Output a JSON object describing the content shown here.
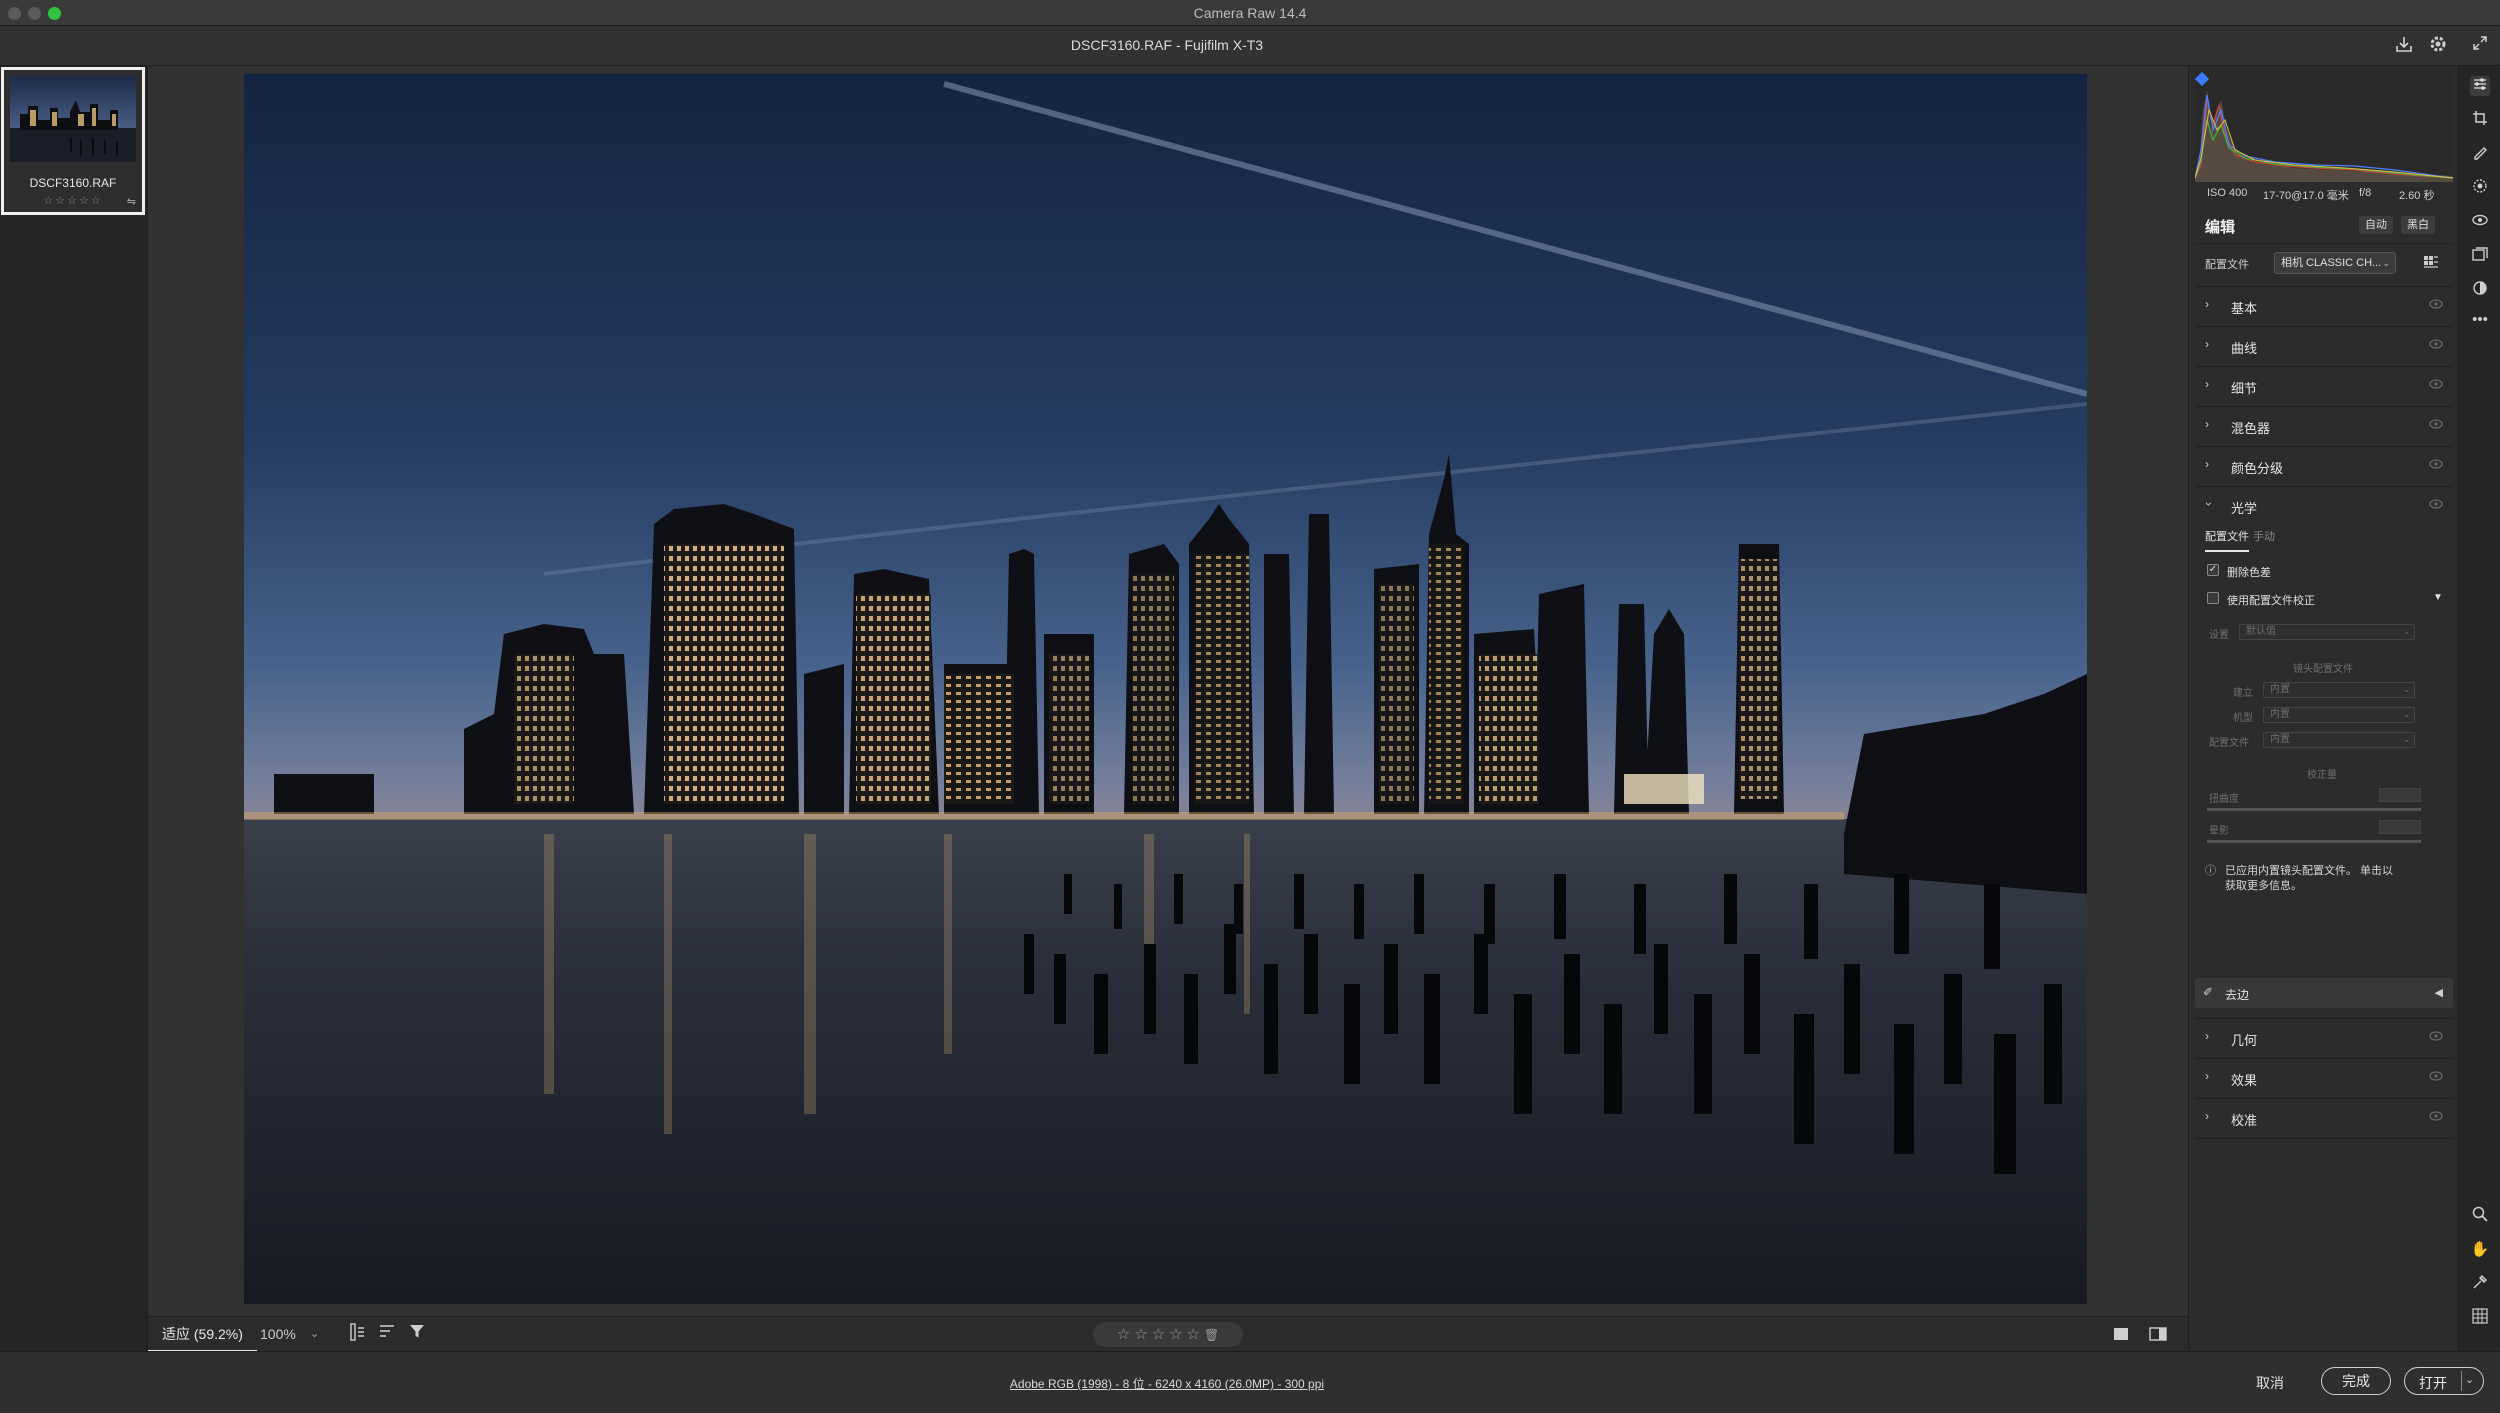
{
  "window": {
    "title": "Camera Raw 14.4"
  },
  "file_header": {
    "title": "DSCF3160.RAF -  Fujifilm X-T3"
  },
  "filmstrip": {
    "items": [
      {
        "name": "DSCF3160.RAF",
        "stars": "☆☆☆☆☆"
      }
    ]
  },
  "bottom_toolbar": {
    "fit_label": "适应 (59.2%)",
    "zoom_label": "100%",
    "rating": "☆☆☆☆☆"
  },
  "status": {
    "file_info": "Adobe RGB (1998) - 8 位 - 6240 x 4160 (26.0MP) - 300 ppi",
    "cancel": "取消",
    "done": "完成",
    "open": "打开"
  },
  "camera_info": {
    "iso": "ISO 400",
    "lens": "17-70@17.0 毫米",
    "aperture": "f/8",
    "shutter": "2.60 秒"
  },
  "edit": {
    "title": "编辑",
    "auto": "自动",
    "bw": "黑白",
    "profile_label": "配置文件",
    "profile_value": "相机 CLASSIC CH..."
  },
  "sections_top": [
    {
      "label": "基本"
    },
    {
      "label": "曲线"
    },
    {
      "label": "细节"
    },
    {
      "label": "混色器"
    },
    {
      "label": "颜色分级"
    },
    {
      "label": "光学"
    }
  ],
  "optics": {
    "tab_profile": "配置文件",
    "tab_manual": "手动",
    "remove_ca": "删除色差",
    "use_profile": "使用配置文件校正",
    "setup_label": "设置",
    "setup_value": "默认值",
    "lens_profile_heading": "镜头配置文件",
    "make_label": "建立",
    "make_value": "内置",
    "model_label": "机型",
    "model_value": "内置",
    "profile_label": "配置文件",
    "profile_value": "内置",
    "amount_heading": "校正量",
    "distortion_label": "扭曲度",
    "vignette_label": "晕影",
    "info_line1": "已应用内置镜头配置文件。 单击以",
    "info_line2": "获取更多信息。",
    "defringe": "去边"
  },
  "sections_bottom": [
    {
      "label": "几何"
    },
    {
      "label": "效果"
    },
    {
      "label": "校准"
    }
  ]
}
